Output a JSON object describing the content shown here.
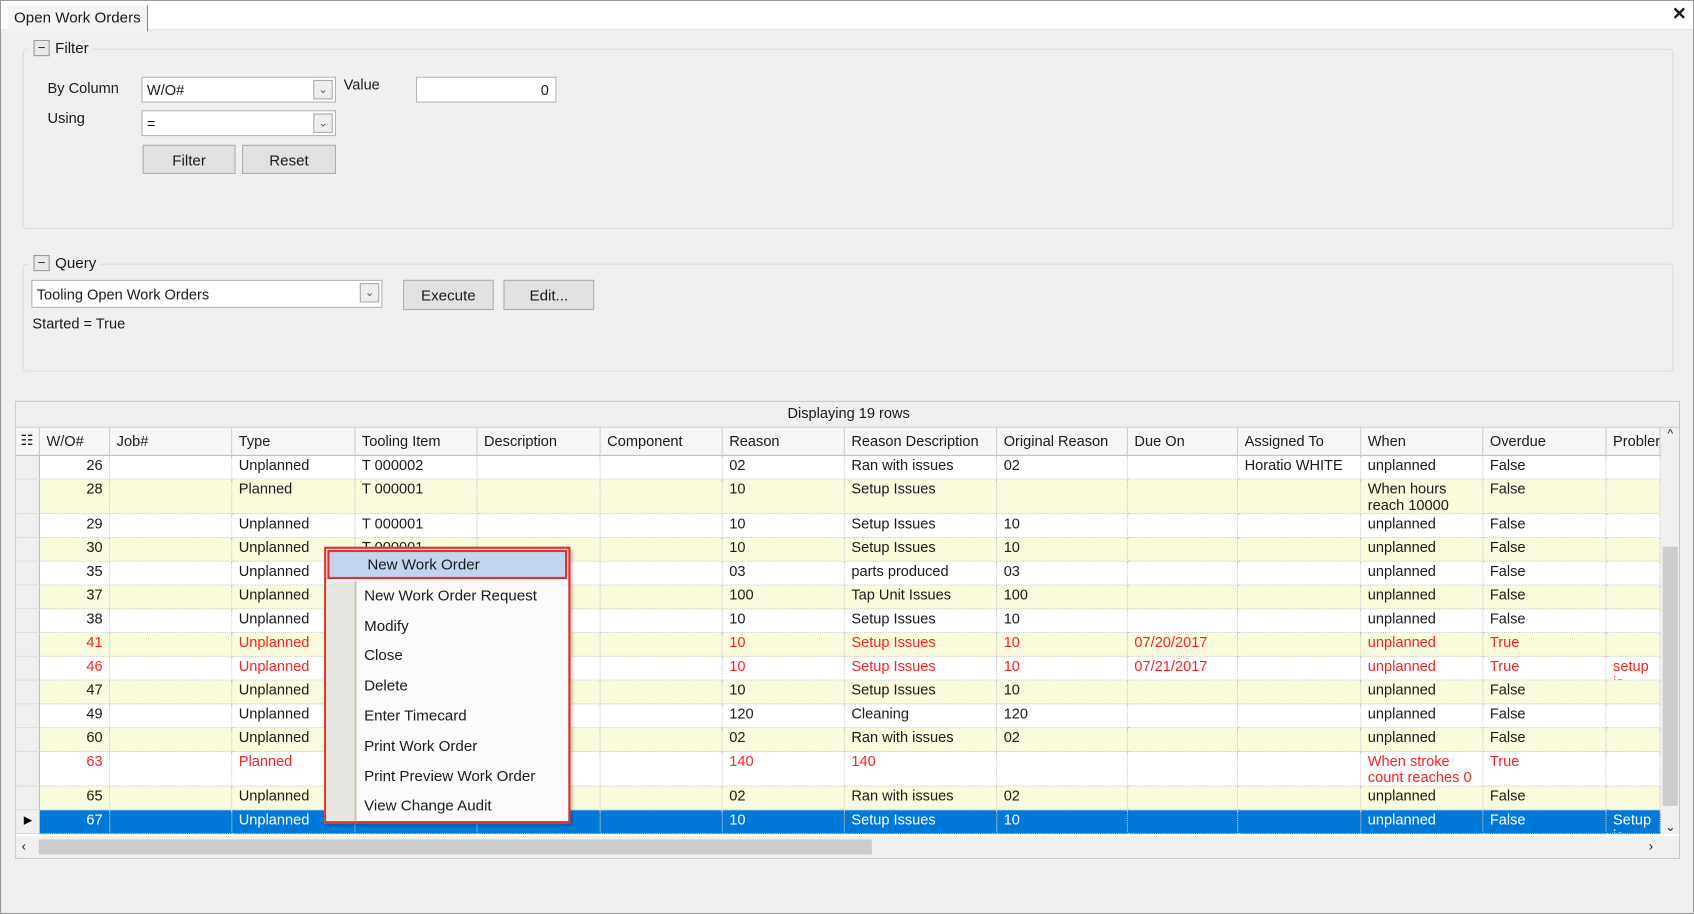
{
  "tab": {
    "title": "Open Work Orders",
    "close": "✕"
  },
  "filter": {
    "title": "Filter",
    "by_column_label": "By Column",
    "by_column_value": "W/O#",
    "using_label": "Using",
    "using_value": "=",
    "value_label": "Value",
    "value": "0",
    "filter_btn": "Filter",
    "reset_btn": "Reset"
  },
  "query": {
    "title": "Query",
    "selected": "Tooling Open Work Orders",
    "execute_btn": "Execute",
    "edit_btn": "Edit...",
    "condition": "Started = True"
  },
  "grid": {
    "caption": "Displaying 19 rows",
    "columns": [
      "W/O#",
      "Job#",
      "Type",
      "Tooling Item",
      "Description",
      "Component",
      "Reason",
      "Reason Description",
      "Original Reason",
      "Due On",
      "Assigned To",
      "When",
      "Overdue",
      "Probler"
    ],
    "rows": [
      {
        "c": [
          "26",
          "",
          "Unplanned",
          "T 000002",
          "",
          "",
          "02",
          "Ran with issues",
          "02",
          "",
          "Horatio WHITE",
          "unplanned",
          "False",
          ""
        ],
        "style": "normal"
      },
      {
        "c": [
          "28",
          "",
          "Planned",
          "T 000001",
          "",
          "",
          "10",
          "Setup Issues",
          "",
          "",
          "",
          "When hours\nreach 10000",
          "False",
          ""
        ],
        "style": "normal"
      },
      {
        "c": [
          "29",
          "",
          "Unplanned",
          "T 000001",
          "",
          "",
          "10",
          "Setup Issues",
          "10",
          "",
          "",
          "unplanned",
          "False",
          ""
        ],
        "style": "normal"
      },
      {
        "c": [
          "30",
          "",
          "Unplanned",
          "T 000001",
          "",
          "",
          "10",
          "Setup Issues",
          "10",
          "",
          "",
          "unplanned",
          "False",
          ""
        ],
        "style": "normal"
      },
      {
        "c": [
          "35",
          "",
          "Unplanned",
          "",
          "",
          "",
          "03",
          "parts produced",
          "03",
          "",
          "",
          "unplanned",
          "False",
          ""
        ],
        "style": "normal"
      },
      {
        "c": [
          "37",
          "",
          "Unplanned",
          "",
          "",
          "",
          "100",
          "Tap Unit Issues",
          "100",
          "",
          "",
          "unplanned",
          "False",
          ""
        ],
        "style": "normal"
      },
      {
        "c": [
          "38",
          "",
          "Unplanned",
          "",
          "",
          "",
          "10",
          "Setup Issues",
          "10",
          "",
          "",
          "unplanned",
          "False",
          ""
        ],
        "style": "normal"
      },
      {
        "c": [
          "41",
          "",
          "Unplanned",
          "",
          "",
          "",
          "10",
          "Setup Issues",
          "10",
          "07/20/2017",
          "",
          "unplanned",
          "True",
          ""
        ],
        "style": "overdue"
      },
      {
        "c": [
          "46",
          "",
          "Unplanned",
          "",
          "",
          "",
          "10",
          "Setup Issues",
          "10",
          "07/21/2017",
          "",
          "unplanned",
          "True",
          "setup is"
        ],
        "style": "overdue"
      },
      {
        "c": [
          "47",
          "",
          "Unplanned",
          "",
          "",
          "",
          "10",
          "Setup Issues",
          "10",
          "",
          "",
          "unplanned",
          "False",
          ""
        ],
        "style": "normal"
      },
      {
        "c": [
          "49",
          "",
          "Unplanned",
          "",
          "",
          "",
          "120",
          "Cleaning",
          "120",
          "",
          "",
          "unplanned",
          "False",
          ""
        ],
        "style": "normal"
      },
      {
        "c": [
          "60",
          "",
          "Unplanned",
          "",
          "",
          "",
          "02",
          "Ran with issues",
          "02",
          "",
          "",
          "unplanned",
          "False",
          ""
        ],
        "style": "normal"
      },
      {
        "c": [
          "63",
          "",
          "Planned",
          "",
          "",
          "",
          "140",
          "140",
          "",
          "",
          "",
          "When stroke\ncount reaches 0",
          "True",
          ""
        ],
        "style": "overdue"
      },
      {
        "c": [
          "65",
          "",
          "Unplanned",
          "",
          "",
          "",
          "02",
          "Ran with issues",
          "02",
          "",
          "",
          "unplanned",
          "False",
          ""
        ],
        "style": "normal"
      },
      {
        "c": [
          "67",
          "",
          "Unplanned",
          "",
          "",
          "",
          "10",
          "Setup Issues",
          "10",
          "",
          "",
          "unplanned",
          "False",
          "Setup is"
        ],
        "style": "selected"
      }
    ]
  },
  "context_menu": {
    "items": [
      "New Work Order",
      "New Work Order Request",
      "Modify",
      "Close",
      "Delete",
      "Enter Timecard",
      "Print Work Order",
      "Print Preview Work Order",
      "View Change Audit"
    ],
    "highlighted": "New Work Order"
  },
  "colors": {
    "row_alt": "#fafadc",
    "overdue_text": "#ff2020",
    "selection": "#0078d7",
    "menu_border": "#e03030",
    "menu_highlight": "#c3d4ef"
  }
}
